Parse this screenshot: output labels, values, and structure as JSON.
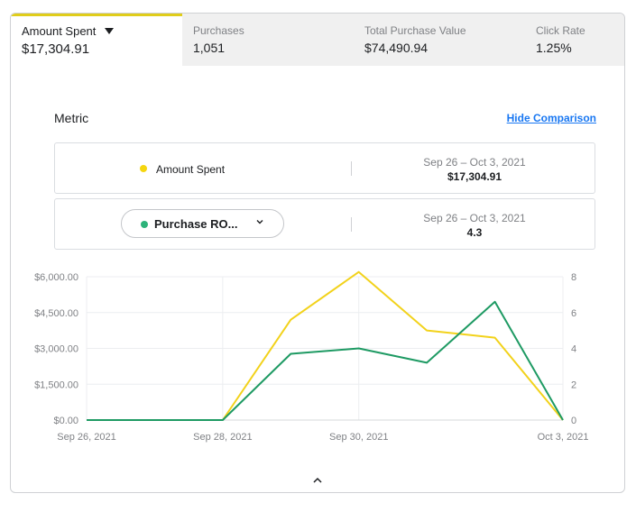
{
  "tabs": [
    {
      "label": "Amount Spent",
      "value": "$17,304.91",
      "active": true
    },
    {
      "label": "Purchases",
      "value": "1,051"
    },
    {
      "label": "Total Purchase Value",
      "value": "$74,490.94"
    },
    {
      "label": "Click Rate",
      "value": "1.25%"
    }
  ],
  "metric": {
    "title": "Metric",
    "hide_comparison": "Hide Comparison"
  },
  "rows": [
    {
      "label": "Amount Spent",
      "date_range": "Sep 26 – Oct 3, 2021",
      "value": "$17,304.91",
      "color": "#f5d60f"
    },
    {
      "label": "Purchase RO...",
      "date_range": "Sep 26 – Oct 3, 2021",
      "value": "4.3",
      "color": "#2db37a",
      "icon": "chevron-down-icon"
    }
  ],
  "chart_data": {
    "type": "line",
    "x": [
      "Sep 26, 2021",
      "Sep 27, 2021",
      "Sep 28, 2021",
      "Sep 29, 2021",
      "Sep 30, 2021",
      "Oct 1, 2021",
      "Oct 2, 2021",
      "Oct 3, 2021"
    ],
    "x_tick_labels": [
      "Sep 26, 2021",
      "Sep 28, 2021",
      "Sep 30, 2021",
      "Oct 3, 2021"
    ],
    "x_tick_indices": [
      0,
      2,
      4,
      7
    ],
    "series": [
      {
        "name": "Amount Spent",
        "axis": "left",
        "color": "#f2d21b",
        "values": [
          0,
          0,
          0,
          4200,
          6200,
          3750,
          3450,
          0
        ]
      },
      {
        "name": "Purchase RO...",
        "axis": "right",
        "color": "#1e9a63",
        "values": [
          0,
          0,
          0,
          3.7,
          4.0,
          3.2,
          6.6,
          0
        ]
      }
    ],
    "y_left": {
      "ticks": [
        0,
        1500,
        3000,
        4500,
        6000
      ],
      "tick_labels": [
        "$0.00",
        "$1,500.00",
        "$3,000.00",
        "$4,500.00",
        "$6,000.00"
      ],
      "range": [
        0,
        6000
      ]
    },
    "y_right": {
      "ticks": [
        0,
        2,
        4,
        6,
        8
      ],
      "tick_labels": [
        "0",
        "2",
        "4",
        "6",
        "8"
      ],
      "range": [
        0,
        8
      ]
    },
    "grid": true
  },
  "footer": {
    "icon": "chevron-up-icon"
  }
}
